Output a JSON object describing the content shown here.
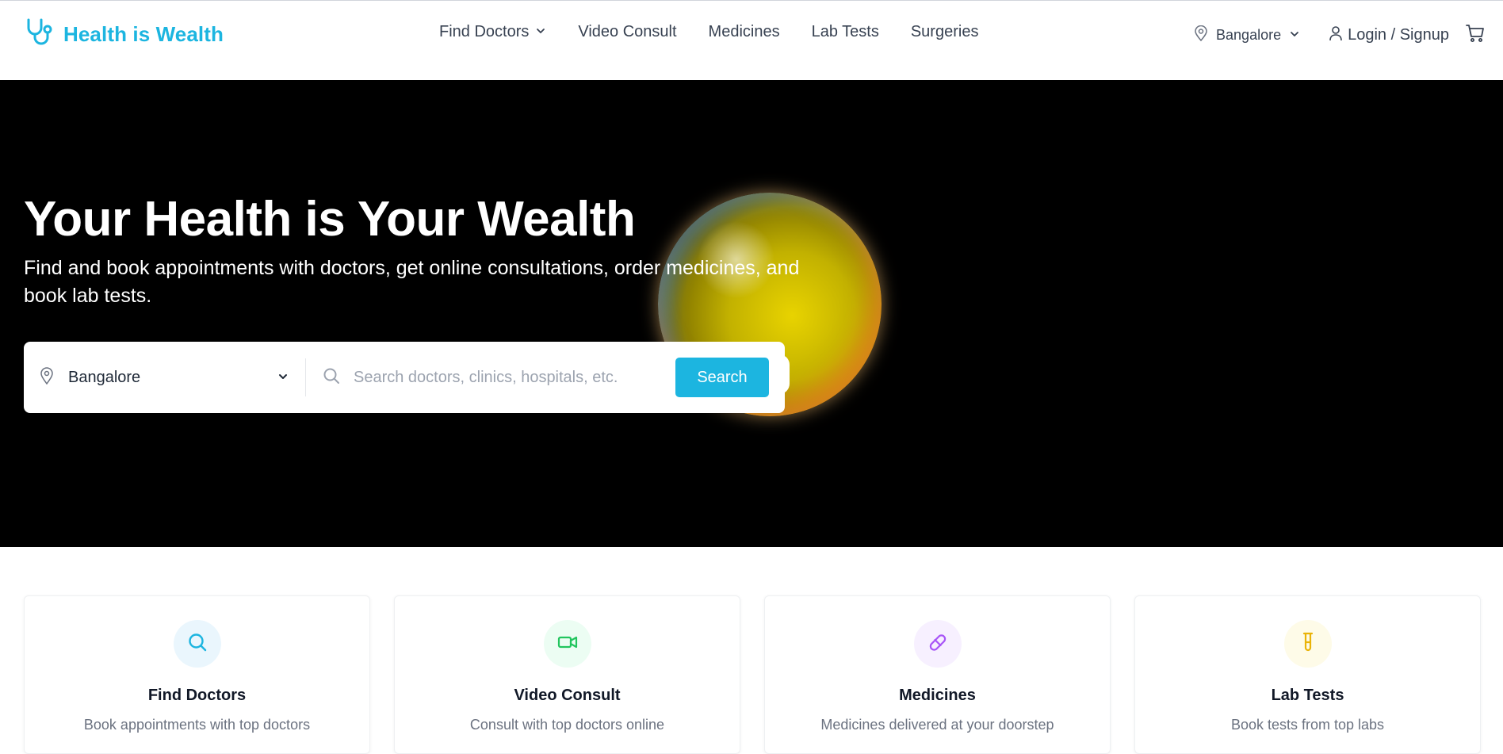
{
  "brand": {
    "name": "Health is Wealth",
    "color": "#1cb5e0"
  },
  "nav": {
    "items": [
      {
        "label": "Find Doctors",
        "has_dropdown": true
      },
      {
        "label": "Video Consult"
      },
      {
        "label": "Medicines"
      },
      {
        "label": "Lab Tests"
      },
      {
        "label": "Surgeries"
      }
    ]
  },
  "header_right": {
    "location": "Bangalore",
    "login_label": "Login / Signup",
    "cart_icon": "cart-icon"
  },
  "hero": {
    "title": "Your Health is Your Wealth",
    "subtitle": "Find and book appointments with doctors, get online consultations, order medicines, and book lab tests."
  },
  "search": {
    "location": "Bangalore",
    "placeholder": "Search doctors, clinics, hospitals, etc.",
    "button_label": "Search"
  },
  "services": [
    {
      "title": "Find Doctors",
      "desc": "Book appointments with top doctors",
      "icon": "search-icon",
      "color": "#1cb5e0",
      "bg": "#eaf6fd"
    },
    {
      "title": "Video Consult",
      "desc": "Consult with top doctors online",
      "icon": "video-icon",
      "color": "#22c55e",
      "bg": "#ecfdf3"
    },
    {
      "title": "Medicines",
      "desc": "Medicines delivered at your doorstep",
      "icon": "pill-icon",
      "color": "#a855f7",
      "bg": "#f7f0ff"
    },
    {
      "title": "Lab Tests",
      "desc": "Book tests from top labs",
      "icon": "test-tube-icon",
      "color": "#eab308",
      "bg": "#fefbe8"
    }
  ]
}
